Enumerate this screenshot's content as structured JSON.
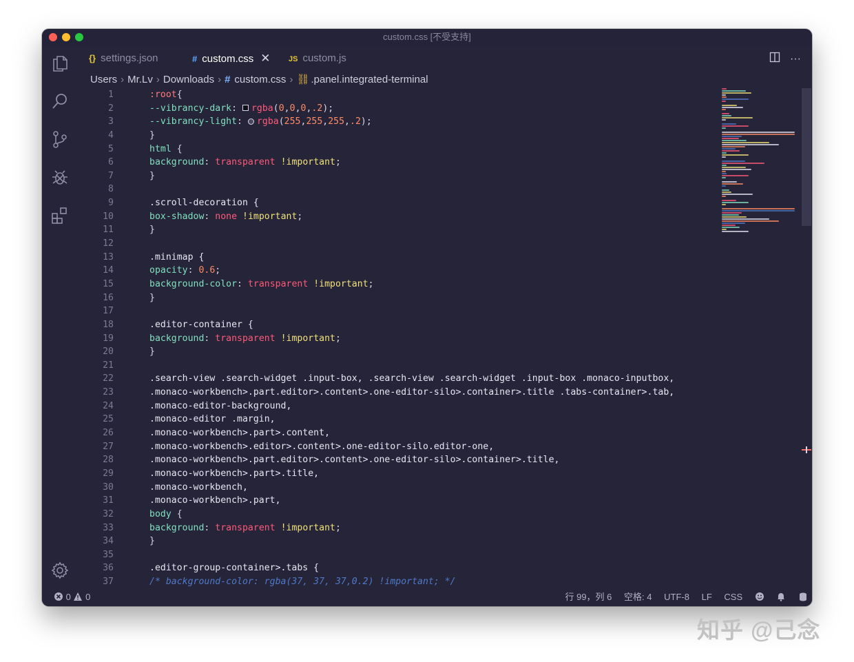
{
  "window": {
    "title": "custom.css [不受支持]"
  },
  "tabs": [
    {
      "icon": "{}",
      "label": "settings.json"
    },
    {
      "icon": "#",
      "label": "custom.css",
      "close": "✕"
    },
    {
      "icon": "JS",
      "label": "custom.js"
    }
  ],
  "breadcrumb": {
    "items": [
      "Users",
      "Mr.Lv",
      "Downloads"
    ],
    "file_icon": "#",
    "file": "custom.css",
    "symbol": ".panel.integrated-terminal"
  },
  "icons": {
    "activity": [
      "explorer-icon",
      "search-icon",
      "source-control-icon",
      "debug-icon",
      "extensions-icon",
      "settings-gear-icon"
    ],
    "tab_actions": [
      "split-editor-icon",
      "more-actions-icon"
    ]
  },
  "colors": {
    "editor_bg": "#262438",
    "selector": "#e8e6f2",
    "property": "#80e0bf",
    "value": "#ff5a7a",
    "important": "#f2e27a",
    "comment": "#4f79c9"
  },
  "editor": {
    "lines": [
      {
        "n": "1",
        "text": ":root{"
      },
      {
        "n": "2",
        "text": "--vibrancy-dark: rgba(0,0,0,.2);"
      },
      {
        "n": "3",
        "text": "--vibrancy-light: rgba(255,255,255,.2);"
      },
      {
        "n": "4",
        "text": "}"
      },
      {
        "n": "5",
        "text": "html {"
      },
      {
        "n": "6",
        "text": "background: transparent !important;"
      },
      {
        "n": "7",
        "text": "}"
      },
      {
        "n": "8",
        "text": ""
      },
      {
        "n": "9",
        "text": ".scroll-decoration {"
      },
      {
        "n": "10",
        "text": "box-shadow: none !important;"
      },
      {
        "n": "11",
        "text": "}"
      },
      {
        "n": "12",
        "text": ""
      },
      {
        "n": "13",
        "text": ".minimap {"
      },
      {
        "n": "14",
        "text": "opacity: 0.6;"
      },
      {
        "n": "15",
        "text": "background-color: transparent !important;"
      },
      {
        "n": "16",
        "text": "}"
      },
      {
        "n": "17",
        "text": ""
      },
      {
        "n": "18",
        "text": ".editor-container {"
      },
      {
        "n": "19",
        "text": "background: transparent !important;"
      },
      {
        "n": "20",
        "text": "}"
      },
      {
        "n": "21",
        "text": ""
      },
      {
        "n": "22",
        "text": ".search-view .search-widget .input-box, .search-view .search-widget .input-box .monaco-inputbox,"
      },
      {
        "n": "23",
        "text": ".monaco-workbench>.part.editor>.content>.one-editor-silo>.container>.title .tabs-container>.tab,"
      },
      {
        "n": "24",
        "text": ".monaco-editor-background,"
      },
      {
        "n": "25",
        "text": ".monaco-editor .margin,"
      },
      {
        "n": "26",
        "text": ".monaco-workbench>.part>.content,"
      },
      {
        "n": "27",
        "text": ".monaco-workbench>.editor>.content>.one-editor-silo.editor-one,"
      },
      {
        "n": "28",
        "text": ".monaco-workbench>.part.editor>.content>.one-editor-silo>.container>.title,"
      },
      {
        "n": "29",
        "text": ".monaco-workbench>.part>.title,"
      },
      {
        "n": "30",
        "text": ".monaco-workbench,"
      },
      {
        "n": "31",
        "text": ".monaco-workbench>.part,"
      },
      {
        "n": "32",
        "text": "body {"
      },
      {
        "n": "33",
        "text": "background: transparent !important;"
      },
      {
        "n": "34",
        "text": "}"
      },
      {
        "n": "35",
        "text": ""
      },
      {
        "n": "36",
        "text": ".editor-group-container>.tabs {"
      },
      {
        "n": "37",
        "text": "/* background-color: rgba(37, 37, 37,0.2) !important; */"
      }
    ]
  },
  "statusbar": {
    "errors": "0",
    "warnings": "0",
    "position": "行 99，列 6",
    "spaces": "空格: 4",
    "encoding": "UTF-8",
    "eol": "LF",
    "language": "CSS"
  },
  "watermark": "知乎 @己念"
}
